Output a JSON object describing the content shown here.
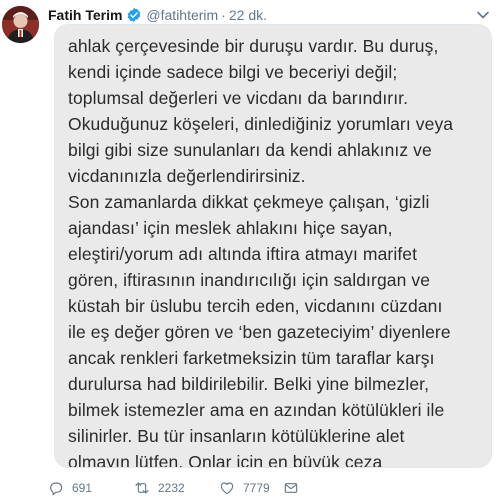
{
  "tweet": {
    "author_name": "Fatih Terim",
    "handle": "@fatihterim",
    "separator": "·",
    "time": "22 dk.",
    "image_text_lines": [
      "ahlak çerçevesinde bir duruşu vardır. Bu duruş,",
      "kendi içinde sadece bilgi ve beceriyi değil;",
      "toplumsal değerleri ve vicdanı da barındırır.",
      "Okuduğunuz köşeleri, dinlediğiniz yorumları veya",
      "bilgi gibi size sunulanları da kendi ahlakınız ve",
      "vicdanınızla değerlendirirsiniz.",
      "Son zamanlarda dikkat çekmeye çalışan, ‘gizli",
      "ajandası’ için meslek ahlakını hiçe sayan,",
      "eleştiri/yorum adı altında iftira atmayı marifet",
      "gören, iftirasının inandırıcılığı için saldırgan ve",
      "küstah bir üslubu tercih eden, vicdanını cüzdanı",
      "ile eş değer gören ve ‘ben gazeteciyim’ diyenlere",
      "ancak renkleri farketmeksizin tüm taraflar karşı",
      "durulursa had bildirilebilir. Belki yine bilmezler,",
      "bilmek istemezler ama en azından kötülükleri ile",
      "silinirler. Bu tür insanların kötülüklerine alet",
      "olmayın lütfen. Onlar için en büyük ceza"
    ],
    "counts": {
      "replies": "691",
      "retweets": "2232",
      "likes": "7779"
    },
    "icons": {
      "verified": "verified-badge-icon",
      "reply": "reply-icon",
      "retweet": "retweet-icon",
      "like": "heart-icon",
      "dm": "envelope-icon",
      "caret": "chevron-down-icon"
    },
    "colors": {
      "verified_blue": "#1da1f2",
      "muted_gray": "#657786",
      "image_background": "#eaeaea"
    }
  }
}
